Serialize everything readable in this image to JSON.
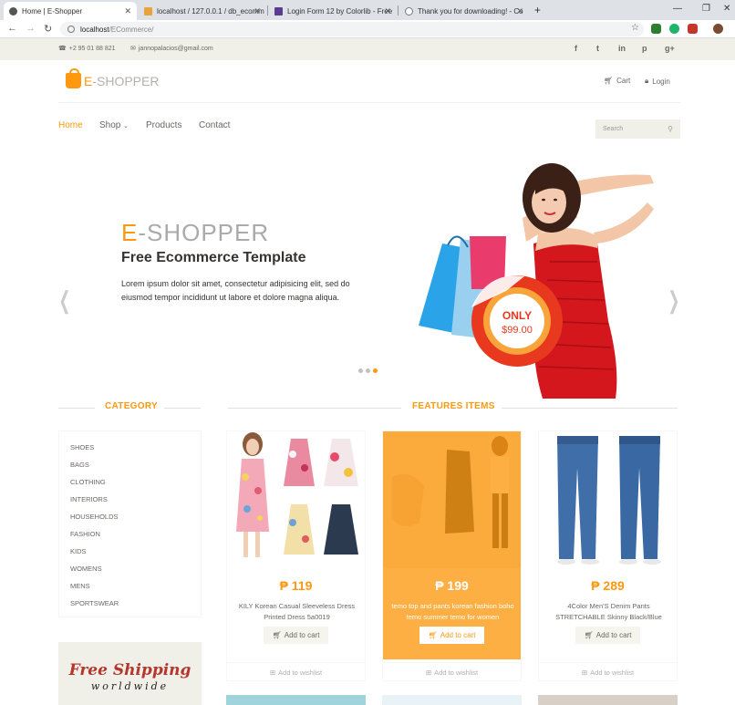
{
  "browser": {
    "tabs": [
      {
        "title": "Home | E-Shopper"
      },
      {
        "title": "localhost / 127.0.0.1 / db_ecomm"
      },
      {
        "title": "Login Form 12 by Colorlib - Free"
      },
      {
        "title": "Thank you for downloading! - Co"
      }
    ],
    "url_host": "localhost",
    "url_path": "/ECommerce/"
  },
  "topbar": {
    "phone": "+2 95 01 88 821",
    "email": "jannopalacios@gmail.com",
    "social": [
      "f",
      "t",
      "in",
      "p",
      "g+"
    ]
  },
  "header": {
    "logo_first": "E",
    "logo_rest": "-SHOPPER",
    "cart": "Cart",
    "login": "Login"
  },
  "nav": {
    "items": [
      "Home",
      "Shop",
      "Products",
      "Contact"
    ],
    "search_placeholder": "Search"
  },
  "slider": {
    "title_first": "E",
    "title_rest": "-SHOPPER",
    "subtitle": "Free Ecommerce Template",
    "text": "Lorem ipsum dolor sit amet, consectetur adipisicing elit, sed do eiusmod tempor incididunt ut labore et dolore magna aliqua.",
    "badge_top": "ONLY",
    "badge_price": "$99.00"
  },
  "sidebar": {
    "title": "CATEGORY",
    "categories": [
      "SHOES",
      "BAGS",
      "CLOTHING",
      "INTERIORS",
      "HOUSEHOLDS",
      "FASHION",
      "KIDS",
      "WOMENS",
      "MENS",
      "SPORTSWEAR"
    ],
    "ship_line1": "Free Shipping",
    "ship_line2": "worldwide"
  },
  "features": {
    "title": "FEATURES ITEMS",
    "products": [
      {
        "price": "₱ 119",
        "name": "KILY Korean Casual Sleeveless Dress Printed Dress 5a0019",
        "cart": "Add to cart",
        "wishlist": "Add to wishlist"
      },
      {
        "price": "₱ 199",
        "name": "temo top and pants korean fashion boho temo summer temo for women",
        "cart": "Add to cart",
        "wishlist": "Add to wishlist"
      },
      {
        "price": "₱ 289",
        "name": "4Color Men'S Denim Pants STRETCHABLE Skinny Black/Blue",
        "cart": "Add to cart",
        "wishlist": "Add to wishlist"
      }
    ]
  },
  "colors": {
    "accent": "#fe980f",
    "topbar_bg": "#f0f0e9",
    "text": "#696763"
  }
}
